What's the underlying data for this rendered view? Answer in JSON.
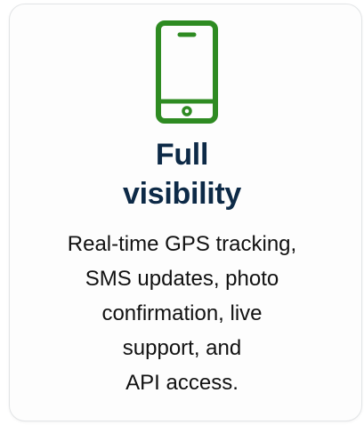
{
  "card": {
    "icon": "smartphone-icon",
    "accent_color": "#2e8b22",
    "title_color": "#0d2a47",
    "title_lines": [
      "Full",
      "visibility"
    ],
    "description_lines": [
      "Real-time GPS tracking,",
      "SMS updates, photo",
      "confirmation, live",
      "support, and",
      "API access."
    ]
  }
}
